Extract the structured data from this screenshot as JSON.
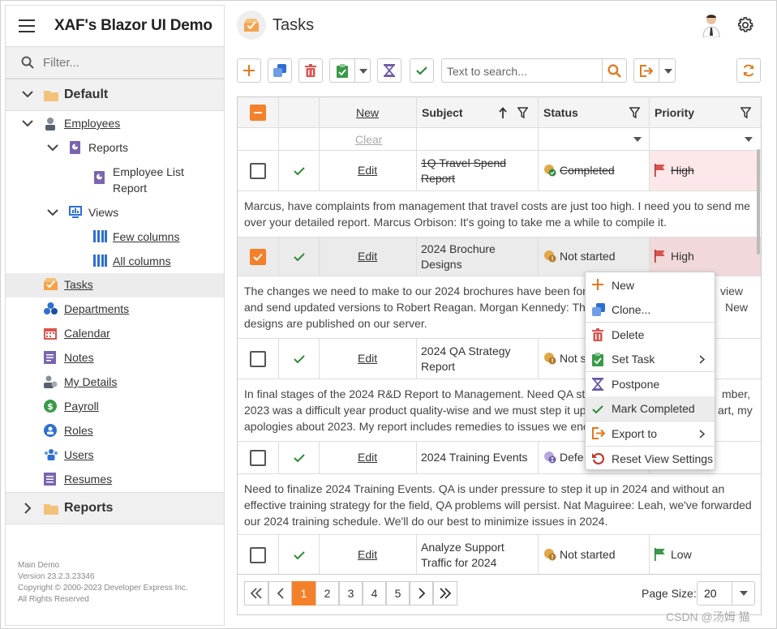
{
  "app": {
    "title": "XAF's Blazor UI Demo"
  },
  "sidebar": {
    "filter_placeholder": "Filter...",
    "group_default": "Default",
    "group_reports": "Reports",
    "items": {
      "employees": "Employees",
      "reports": "Reports",
      "employee_list_report_1": "Employee List",
      "employee_list_report_2": "Report",
      "views": "Views",
      "few_columns": "Few columns",
      "all_columns": "All columns",
      "tasks": "Tasks",
      "departments": "Departments",
      "calendar": "Calendar",
      "notes": "Notes",
      "my_details": "My Details",
      "payroll": "Payroll",
      "roles": "Roles",
      "users": "Users",
      "resumes": "Resumes"
    },
    "footer": [
      "Main Demo",
      "Version 23.2.3.23346",
      "Copyright © 2000-2023 Developer Express Inc.",
      "All Rights Reserved"
    ]
  },
  "header": {
    "title": "Tasks"
  },
  "toolbar": {
    "search_placeholder": "Text to search..."
  },
  "grid": {
    "columns": {
      "new": "New",
      "subject": "Subject",
      "status": "Status",
      "priority": "Priority"
    },
    "clear": "Clear",
    "edit_label": "Edit",
    "rows": [
      {
        "subject1": "1Q Travel Spend",
        "subject2": "Report",
        "status": "Completed",
        "priority": "High",
        "note1": "Marcus, have complaints from management that travel costs are just too high. I need you to send me",
        "note2": "over your detailed report. Marcus Orbison: It's going to take me a while to compile it.",
        "note3": ""
      },
      {
        "subject1": "2024 Brochure",
        "subject2": "Designs",
        "status": "Not started",
        "priority": "High",
        "note1": "The changes we need to make to our 2024 brochures have been forw",
        "note1b": "view",
        "note2": "and send updated versions to Robert Reagan. Morgan Kennedy: This",
        "note2b": "New",
        "note3": "designs are published on our server."
      },
      {
        "subject1": "2024 QA Strategy",
        "subject2": "Report",
        "status": "Not s",
        "note1": "In final stages of the 2024 R&D Report to Management. Need QA st",
        "note1b": "mber,",
        "note2": "2023 was a difficult year product quality-wise and we must step it up",
        "note2b": "art, my",
        "note3": "apologies about 2023. My report includes remedies to issues we enc"
      },
      {
        "subject1": "2024 Training Events",
        "subject2": "",
        "status": "Defe",
        "note1": "Need to finalize 2024 Training Events. QA is under pressure to step it up in 2024 and without an",
        "note2": "effective training strategy for the field, QA problems will persist. Nat Maguiree: Leah, we've forwarded",
        "note3": "our 2024 training schedule. We'll do our best to minimize issues in 2024."
      },
      {
        "subject1": "Analyze Support",
        "subject2": "Traffic for 2024",
        "status": "Not started",
        "priority": "Low"
      }
    ]
  },
  "pager": {
    "pages": [
      "1",
      "2",
      "3",
      "4",
      "5"
    ],
    "page_size_label": "Page Size:",
    "page_size": "20"
  },
  "context_menu": {
    "new": "New",
    "clone": "Clone...",
    "delete": "Delete",
    "set_task": "Set Task",
    "postpone": "Postpone",
    "mark_completed": "Mark Completed",
    "export_to": "Export to",
    "reset_view": "Reset View Settings"
  },
  "watermark": "CSDN @汤姆 猫",
  "colors": {
    "accent": "#f5802a",
    "check": "#2e8b3a",
    "flag_red": "#d9534f",
    "flag_green": "#3a9a48",
    "purple": "#6e5aa8",
    "blue": "#2f6fd0"
  }
}
